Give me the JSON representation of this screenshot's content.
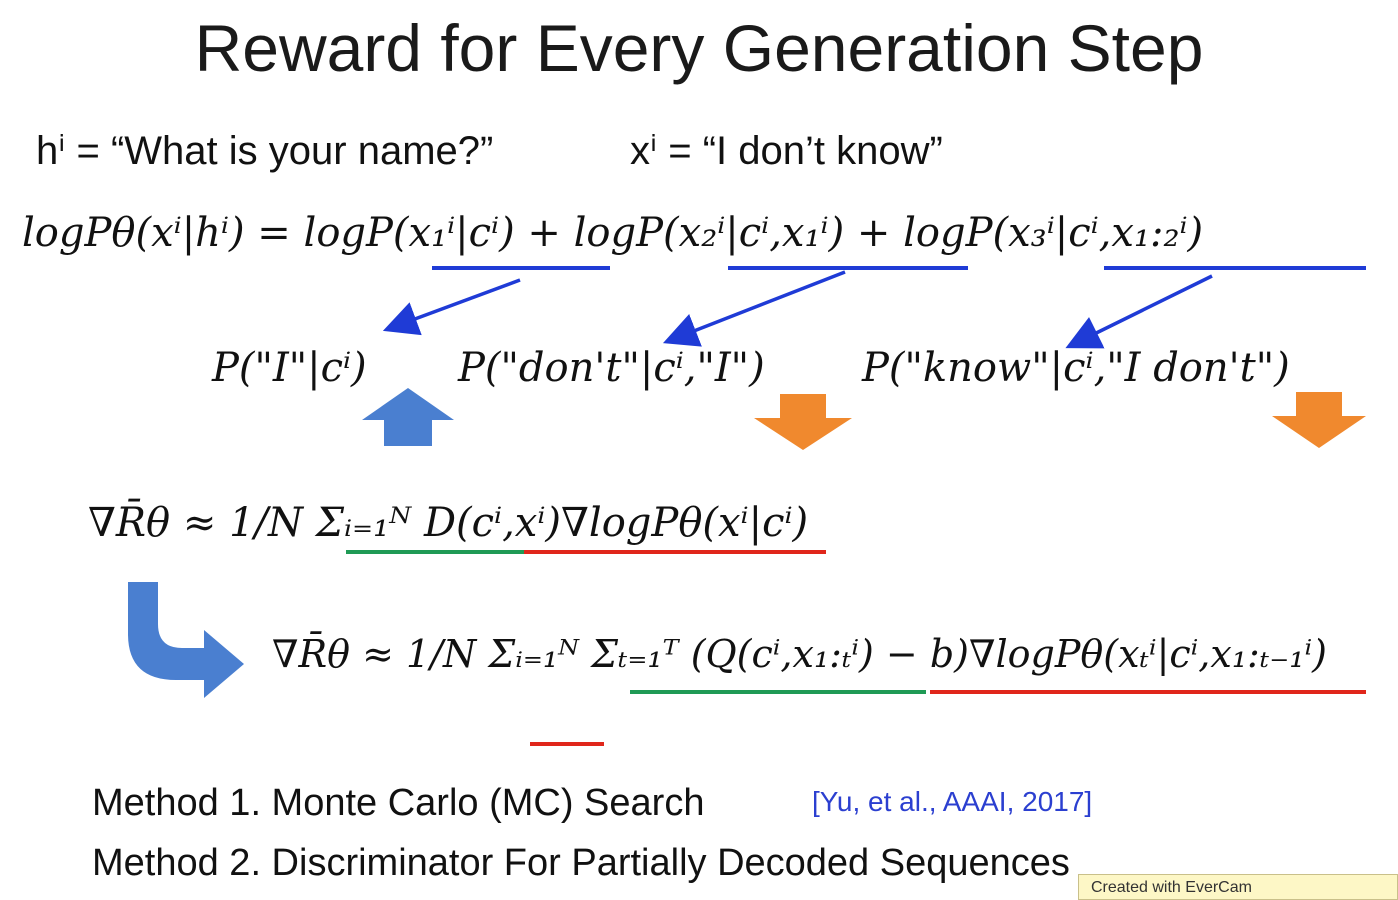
{
  "title": "Reward for Every Generation Step",
  "definitions": {
    "h_def": "hⁱ = “What is your name?”",
    "x_def": "xⁱ = “I don’t know”"
  },
  "equations": {
    "decomposition": "logPθ(xⁱ|hⁱ) = logP(x₁ⁱ|cⁱ) + logP(x₂ⁱ|cⁱ,x₁ⁱ) + logP(x₃ⁱ|cⁱ,x₁:₂ⁱ)",
    "term1": "P(\"I\"|cⁱ)",
    "term2": "P(\"don't\"|cⁱ,\"I\")",
    "term3": "P(\"know\"|cⁱ,\"I don't\")",
    "gradient_seq": "∇R̄θ ≈ 1/N Σᵢ₌₁ᴺ D(cⁱ,xⁱ)∇logPθ(xⁱ|cⁱ)",
    "gradient_step": "∇R̄θ ≈ 1/N Σᵢ₌₁ᴺ Σₜ₌₁ᵀ (Q(cⁱ,x₁:ₜⁱ) − b)∇logPθ(xₜⁱ|cⁱ,x₁:ₜ₋₁ⁱ)"
  },
  "methods": [
    {
      "label": "Method 1. Monte Carlo (MC) Search",
      "citation": "[Yu, et al., AAAI, 2017]"
    },
    {
      "label": "Method 2. Discriminator For Partially Decoded Sequences"
    }
  ],
  "watermark": "Created with EverCam",
  "colors": {
    "underline_blue": "#1f3bd6",
    "underline_green": "#1f9a55",
    "underline_red": "#e0261b",
    "arrow_up_blue": "#4a7fd0",
    "arrow_down_orange": "#f0892e",
    "cite_blue": "#2b3fd0"
  },
  "icons": {
    "up": "arrow-up-icon",
    "down": "arrow-down-icon",
    "curve": "curved-arrow-icon"
  }
}
